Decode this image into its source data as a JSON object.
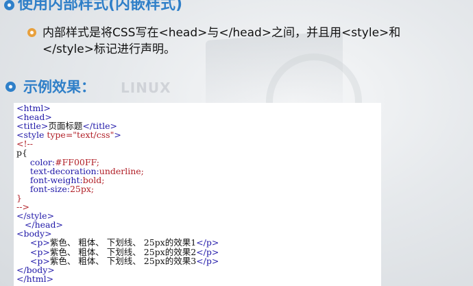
{
  "slide": {
    "heading1": "使用内部样式(内嵌样式)",
    "body_line1": "内部样式是将CSS写在<head>与</head>之间，并且用<style>和",
    "body_line2": "</style>标记进行声明。",
    "heading2": "示例效果：",
    "background_logo": "LINUX"
  },
  "code": {
    "lines": [
      [
        {
          "t": "tag",
          "v": "<html>"
        }
      ],
      [
        {
          "t": "tag",
          "v": "<head>"
        }
      ],
      [
        {
          "t": "tag",
          "v": "<title>"
        },
        {
          "t": "text",
          "v": "页面标题"
        },
        {
          "t": "tag",
          "v": "</title>"
        }
      ],
      [
        {
          "t": "tag",
          "v": "<style "
        },
        {
          "t": "attr",
          "v": "type=\"text/css\""
        },
        {
          "t": "tag",
          "v": ">"
        }
      ],
      [
        {
          "t": "val",
          "v": "<!--"
        }
      ],
      [
        {
          "t": "text",
          "v": "p{"
        }
      ],
      [
        {
          "t": "text",
          "v": "     "
        },
        {
          "t": "prop",
          "v": "color:"
        },
        {
          "t": "val",
          "v": "#FF00FF;"
        }
      ],
      [
        {
          "t": "text",
          "v": "     "
        },
        {
          "t": "prop",
          "v": "text-decoration:"
        },
        {
          "t": "val",
          "v": "underline;"
        }
      ],
      [
        {
          "t": "text",
          "v": "     "
        },
        {
          "t": "prop",
          "v": "font-weight:"
        },
        {
          "t": "val",
          "v": "bold;"
        }
      ],
      [
        {
          "t": "text",
          "v": "     "
        },
        {
          "t": "prop",
          "v": "font-size:"
        },
        {
          "t": "val",
          "v": "25px;"
        }
      ],
      [
        {
          "t": "val",
          "v": "}"
        }
      ],
      [
        {
          "t": "val",
          "v": "-->"
        }
      ],
      [
        {
          "t": "tag",
          "v": "</style>"
        }
      ],
      [
        {
          "t": "text",
          "v": "   "
        },
        {
          "t": "tag",
          "v": "</head>"
        }
      ],
      [
        {
          "t": "tag",
          "v": "<body>"
        }
      ],
      [
        {
          "t": "text",
          "v": "     "
        },
        {
          "t": "tag",
          "v": "<p>"
        },
        {
          "t": "text",
          "v": "紫色、 粗体、 下划线、 25px的效果1"
        },
        {
          "t": "tag",
          "v": "</p>"
        }
      ],
      [
        {
          "t": "text",
          "v": "     "
        },
        {
          "t": "tag",
          "v": "<p>"
        },
        {
          "t": "text",
          "v": "紫色、 粗体、 下划线、 25px的效果2"
        },
        {
          "t": "tag",
          "v": "</p>"
        }
      ],
      [
        {
          "t": "text",
          "v": "     "
        },
        {
          "t": "tag",
          "v": "<p>"
        },
        {
          "t": "text",
          "v": "紫色、 粗体、 下划线、 25px的效果3"
        },
        {
          "t": "tag",
          "v": "</p>"
        }
      ],
      [
        {
          "t": "tag",
          "v": "</body>"
        }
      ],
      [
        {
          "t": "tag",
          "v": "</html>"
        }
      ]
    ]
  },
  "colors": {
    "heading": "#2f7fc8",
    "tag": "#1f17a8",
    "value": "#b01d25",
    "bullet_blue": "#2f80c9",
    "bullet_orange": "#e8a03c"
  }
}
